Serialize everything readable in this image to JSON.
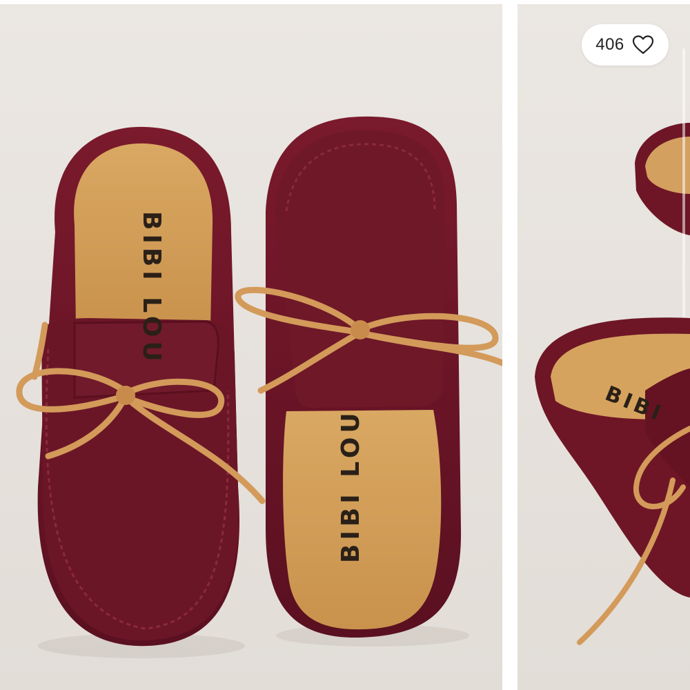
{
  "like_button": {
    "count": "406",
    "icon": "heart-outline-icon"
  },
  "product_images": [
    {
      "insole_brand_left": "BIBI LOU",
      "insole_brand_right": "BIBI LOU"
    },
    {
      "insole_brand": "BIBI"
    }
  ],
  "colors": {
    "page_background": "#ffffff",
    "photo_background": "#e8e4df",
    "calf_hair": "#6e1626",
    "insole": "#d7a45e",
    "lace": "#d39a5a"
  }
}
